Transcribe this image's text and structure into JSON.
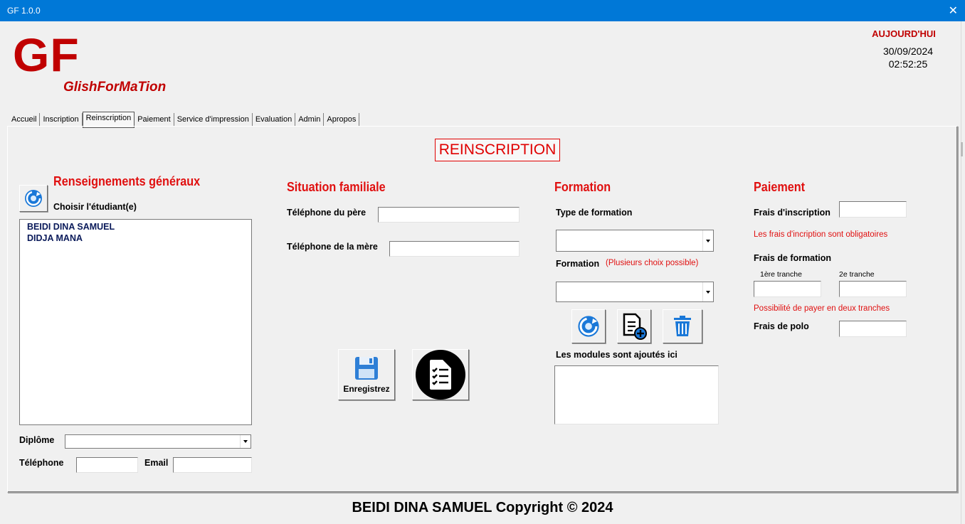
{
  "window": {
    "title": "GF 1.0.0",
    "close_glyph": "✕"
  },
  "brand": {
    "logo": "GF",
    "slogan": "GlishForMaTion"
  },
  "clock": {
    "label": "AUJOURD'HUI",
    "date": "30/09/2024",
    "time": "02:52:25"
  },
  "tabs": [
    "Accueil",
    "Inscription",
    "Reinscription",
    "Paiement",
    "Service d'impression",
    "Evaluation",
    "Admin",
    "Apropos"
  ],
  "active_tab": "Reinscription",
  "page_title": "REINSCRIPTION",
  "general": {
    "heading": "Renseignements généraux",
    "choose_label": "Choisir l'étudiant(e)",
    "students": [
      "BEIDI DINA SAMUEL",
      "DIDJA MANA"
    ],
    "diploma_label": "Diplôme",
    "diploma_value": "",
    "phone_label": "Téléphone",
    "phone_value": "",
    "email_label": "Email",
    "email_value": "",
    "refresh_icon": "refresh-icon"
  },
  "family": {
    "heading": "Situation familiale",
    "father_phone_label": "Téléphone du père",
    "father_phone_value": "",
    "mother_phone_label": "Téléphone de la mère",
    "mother_phone_value": ""
  },
  "actions": {
    "save_label": "Enregistrez",
    "save_icon": "floppy-disk-icon",
    "list_icon": "checklist-icon"
  },
  "training": {
    "heading": "Formation",
    "type_label": "Type de formation",
    "type_value": "",
    "formation_label": "Formation",
    "formation_hint": "(Plusieurs choix possible)",
    "formation_value": "",
    "modules_label": "Les modules sont ajoutés ici",
    "buttons": [
      "refresh-icon",
      "add-document-icon",
      "trash-icon"
    ]
  },
  "payment": {
    "heading": "Paiement",
    "registration_fee_label": "Frais d'inscription",
    "registration_fee_value": "",
    "registration_note": "Les frais d'incription sont obligatoires",
    "training_fee_label": "Frais de formation",
    "tranche1_label": "1ère tranche",
    "tranche1_value": "",
    "tranche2_label": "2e tranche",
    "tranche2_value": "",
    "tranche_note": "Possibilité de payer en deux tranches",
    "polo_label": "Frais de polo",
    "polo_value": ""
  },
  "footer": "BEIDI DINA SAMUEL Copyright © 2024",
  "colors": {
    "accent": "#c00000",
    "heading_red": "#e01010",
    "titlebar": "#0078d7",
    "list_text": "#0a1a5a"
  }
}
